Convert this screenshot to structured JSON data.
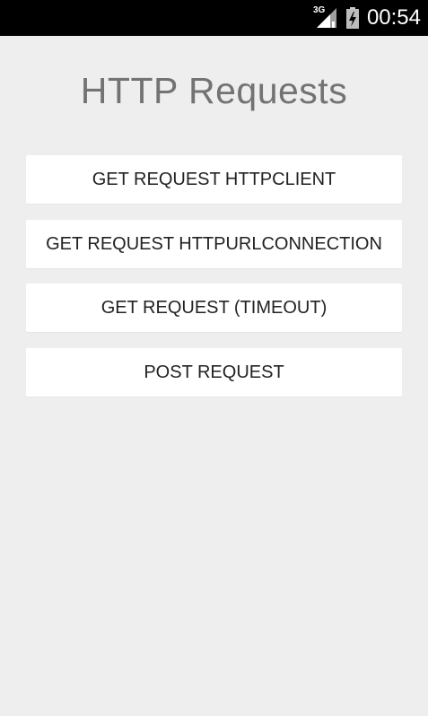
{
  "status_bar": {
    "network_label": "3G",
    "time": "00:54",
    "icons": [
      "signal-icon",
      "battery-charging-icon"
    ],
    "background": "#000000"
  },
  "screen": {
    "title": "HTTP Requests",
    "background": "#eeeeee"
  },
  "buttons": [
    {
      "label": "GET REQUEST HTTPCLIENT"
    },
    {
      "label": "GET REQUEST HTTPURLCONNECTION"
    },
    {
      "label": "GET REQUEST (TIMEOUT)"
    },
    {
      "label": "POST REQUEST"
    }
  ]
}
